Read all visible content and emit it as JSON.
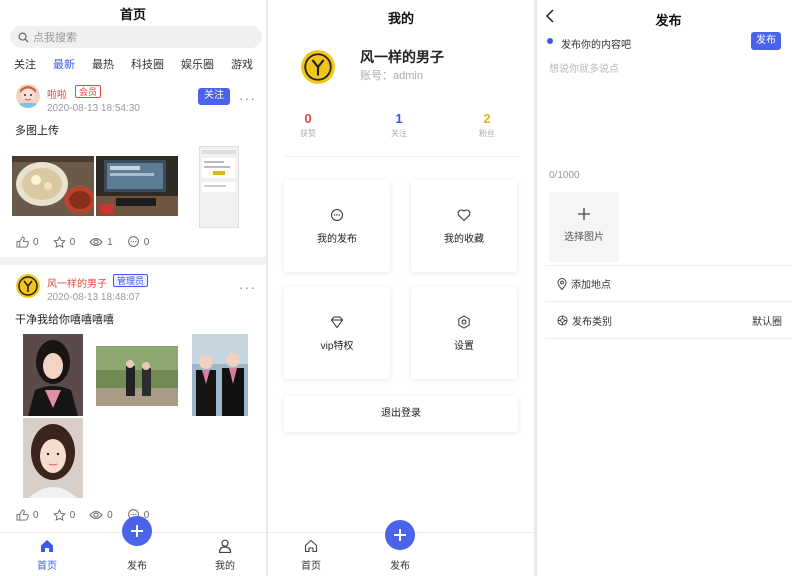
{
  "home": {
    "title": "首页",
    "search_placeholder": "点我搜索",
    "tabs": [
      "关注",
      "最新",
      "最热",
      "科技圈",
      "娱乐圈",
      "游戏"
    ],
    "active_tab": "最新",
    "posts": [
      {
        "user": "啦啦",
        "badge": "会员",
        "time": "2020-08-13 18:54:30",
        "text": "多图上传",
        "follow_label": "关注",
        "likes": "0",
        "stars": "0",
        "views": "1",
        "comments": "0"
      },
      {
        "user": "风一样的男子",
        "badge": "管理员",
        "time": "2020-08-13 18:48:07",
        "text": "干净我给你嘻嘻嘻嘻",
        "likes": "0",
        "stars": "0",
        "views": "0",
        "comments": "0"
      }
    ],
    "tabbar": {
      "home": "首页",
      "publish": "发布",
      "mine": "我的"
    }
  },
  "mine": {
    "title": "我的",
    "name": "风一样的男子",
    "account": "账号：admin",
    "stats": [
      {
        "value": "0",
        "label": "获赞",
        "color": "#e0473f"
      },
      {
        "value": "1",
        "label": "关注",
        "color": "#3b5ce8"
      },
      {
        "value": "2",
        "label": "粉丝",
        "color": "#e6b31e"
      }
    ],
    "cards": {
      "posts": "我的发布",
      "favorites": "我的收藏",
      "vip": "vip特权",
      "settings": "设置"
    },
    "logout": "退出登录",
    "tabbar": {
      "home": "首页",
      "publish": "发布"
    }
  },
  "publish": {
    "title": "发布",
    "section_label": "发布你的内容吧",
    "button": "发布",
    "placeholder": "想说你就多说点",
    "counter": "0/1000",
    "add_image": "选择图片",
    "add_location": "添加地点",
    "category_label": "发布类别",
    "category_value": "默认圈"
  },
  "colors": {
    "accent": "#4a63e8",
    "red": "#e0473f",
    "yellow": "#e6b31e"
  }
}
